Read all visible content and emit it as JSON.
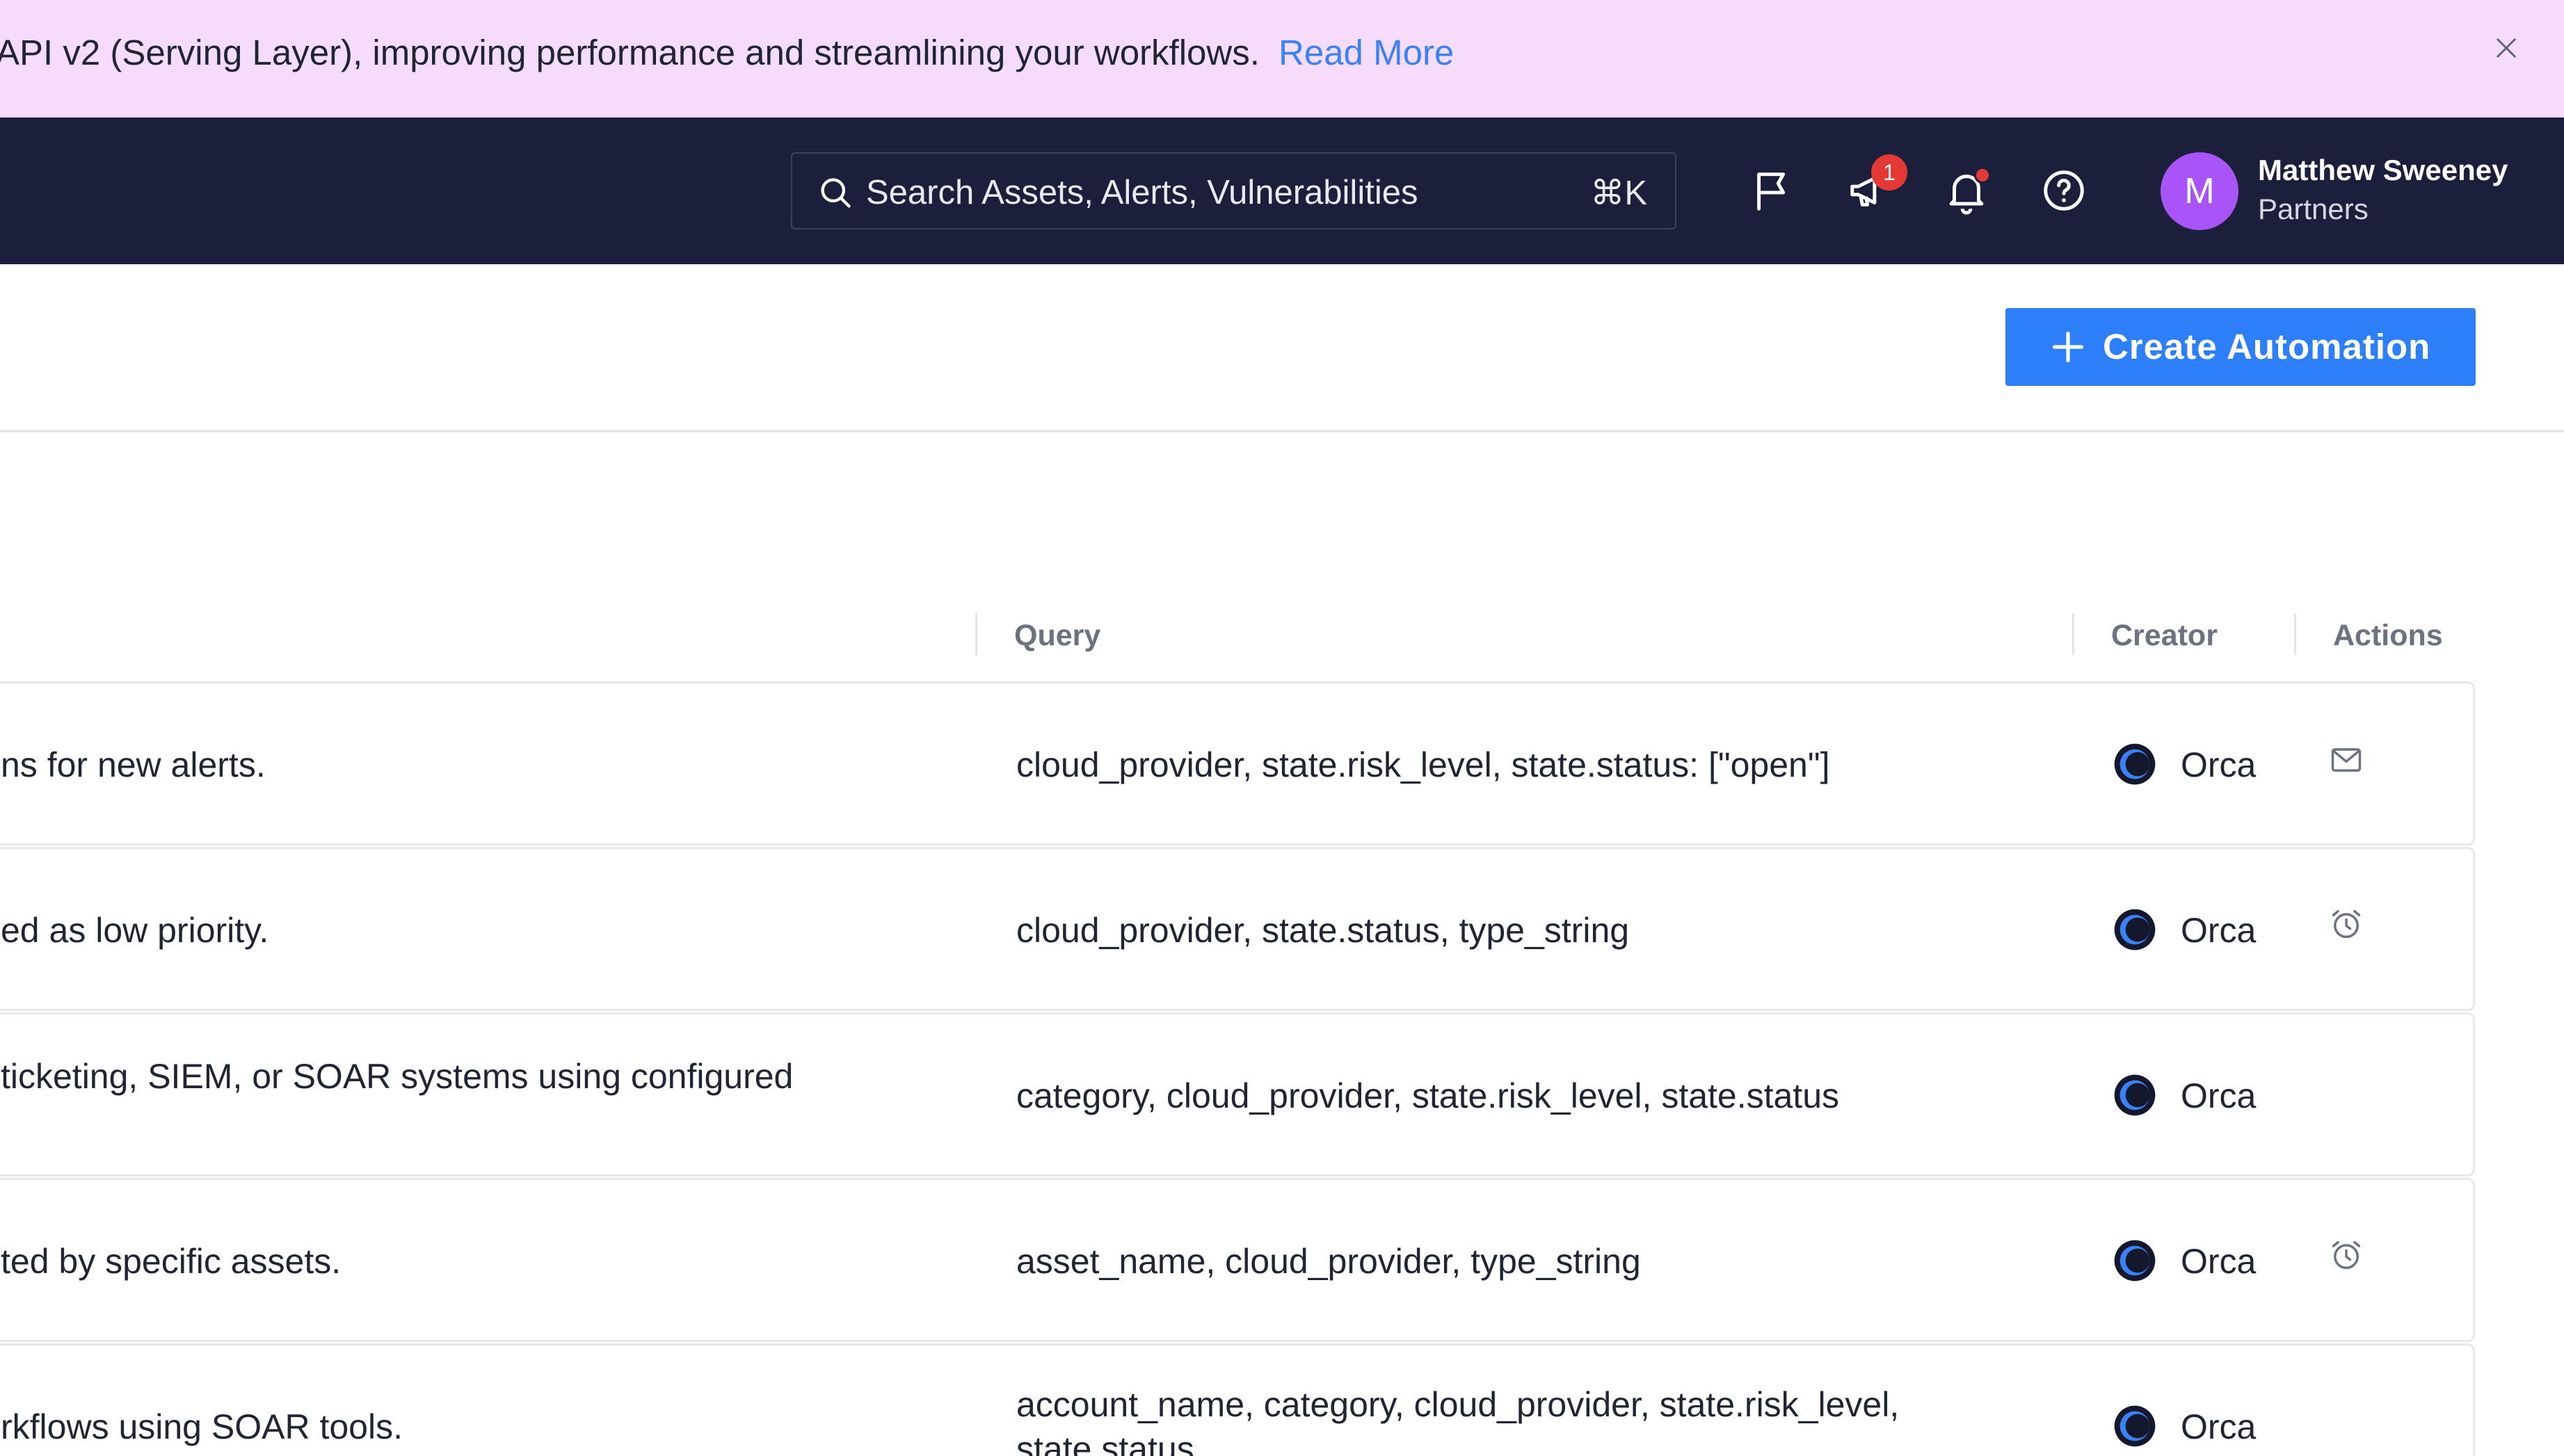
{
  "banner": {
    "text": "API v2 (Serving Layer), improving performance and streamlining your workflows.",
    "link": "Read More",
    "close_icon": "close-icon"
  },
  "topnav": {
    "search": {
      "placeholder": "Search Assets, Alerts, Vulnerabilities",
      "shortcut": "⌘K"
    },
    "icons": [
      "flag-icon",
      "megaphone-icon",
      "bell-icon",
      "help-icon"
    ],
    "notifications_badge": "1",
    "user": {
      "initial": "M",
      "name": "Matthew Sweeney",
      "org": "Partners"
    }
  },
  "header": {
    "create_button": "Create Automation"
  },
  "table": {
    "columns": {
      "query": "Query",
      "creator": "Creator",
      "actions": "Actions"
    },
    "rows": [
      {
        "description": "ns for new alerts.",
        "query": "cloud_provider, state.risk_level, state.status: [\"open\"]",
        "creator": "Orca",
        "action_icon": "mail-icon"
      },
      {
        "description": "ed as low priority.",
        "query": "cloud_provider, state.status, type_string",
        "creator": "Orca",
        "action_icon": "alarm-clock-icon"
      },
      {
        "description": "ticketing, SIEM, or SOAR systems using configured",
        "query": "category, cloud_provider, state.risk_level, state.status",
        "creator": "Orca",
        "action_icon": ""
      },
      {
        "description": "ted by specific assets.",
        "query": "asset_name, cloud_provider, type_string",
        "creator": "Orca",
        "action_icon": "alarm-clock-icon"
      },
      {
        "description": "rkflows using SOAR tools.",
        "query_line1": "account_name, category, cloud_provider, state.risk_level,",
        "query_line2": "state.status",
        "creator": "Orca",
        "action_icon": ""
      }
    ]
  },
  "colors": {
    "banner_bg": "#f6dcfb",
    "nav_bg": "#1b1f3b",
    "accent": "#2d7ff9",
    "avatar": "#a855f7",
    "badge": "#e53935"
  }
}
